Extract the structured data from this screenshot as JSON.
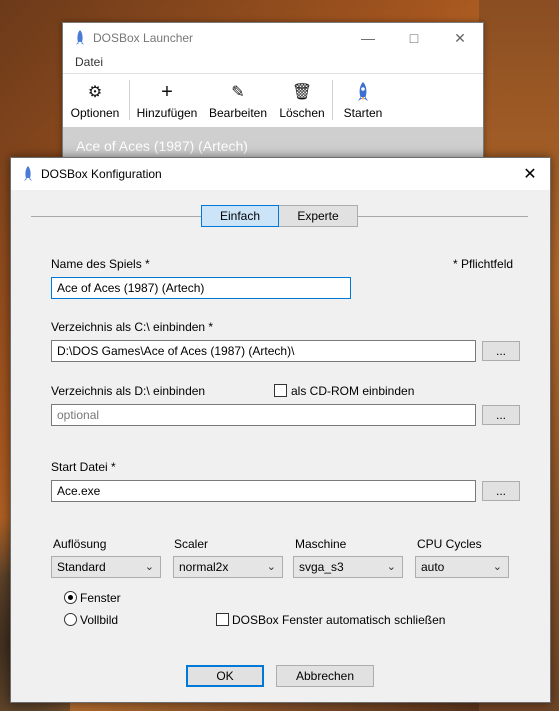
{
  "launcher": {
    "title": "DOSBox Launcher",
    "menu": [
      "Datei"
    ],
    "toolbar": {
      "options": "Optionen",
      "add": "Hinzufügen",
      "edit": "Bearbeiten",
      "delete": "Löschen",
      "start": "Starten"
    },
    "selected_game": "Ace of Aces (1987) (Artech)"
  },
  "dialog": {
    "title": "DOSBox Konfiguration",
    "tabs": {
      "simple": "Einfach",
      "expert": "Experte"
    },
    "required_note": "* Pflichtfeld",
    "name_label": "Name des Spiels *",
    "name_value": "Ace of Aces (1987) (Artech)",
    "c_label": "Verzeichnis als C:\\ einbinden *",
    "c_value": "D:\\DOS Games\\Ace of Aces (1987) (Artech)\\",
    "d_label": "Verzeichnis als D:\\ einbinden",
    "cdrom_label": "als CD-ROM einbinden",
    "d_placeholder": "optional",
    "start_label": "Start Datei *",
    "start_value": "Ace.exe",
    "browse": "...",
    "resolution_label": "Auflösung",
    "resolution_value": "Standard",
    "scaler_label": "Scaler",
    "scaler_value": "normal2x",
    "machine_label": "Maschine",
    "machine_value": "svga_s3",
    "cycles_label": "CPU Cycles",
    "cycles_value": "auto",
    "window_label": "Fenster",
    "fullscreen_label": "Vollbild",
    "autoclose_label": "DOSBox Fenster automatisch schließen",
    "ok": "OK",
    "cancel": "Abbrechen"
  },
  "colors": {
    "accent": "#0078d7",
    "tab_active": "#cce4f7",
    "selection": "#cfcfcf"
  }
}
